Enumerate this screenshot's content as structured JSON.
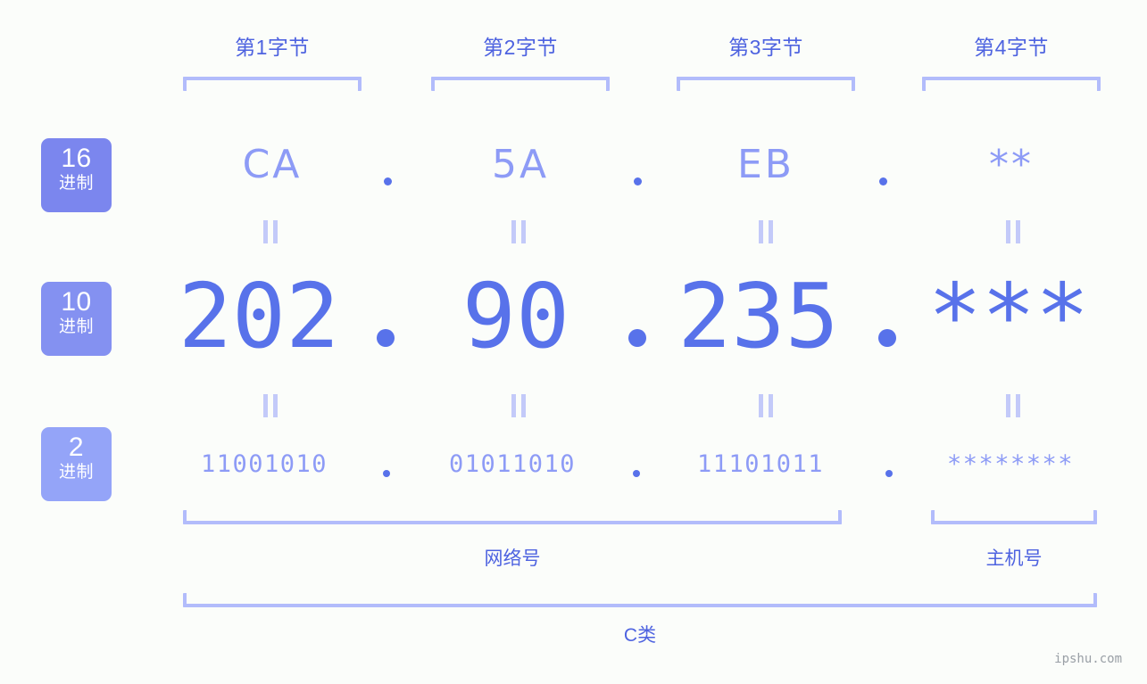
{
  "background_color": "#fbfdfa",
  "accent_colors": {
    "bracket": "#b2bcfb",
    "label_text": "#4e63e0",
    "value_strong": "#5872ea",
    "value_soft": "#8d9bf6",
    "equals": "#c3caf9",
    "badge_hex": "#7b86ee",
    "badge_dec": "#8491f1",
    "badge_bin": "#94a4f8",
    "watermark": "#9aa0a6"
  },
  "byte_headers": [
    {
      "label": "第1字节"
    },
    {
      "label": "第2字节"
    },
    {
      "label": "第3字节"
    },
    {
      "label": "第4字节"
    }
  ],
  "badges": [
    {
      "number": "16",
      "suffix": "进制"
    },
    {
      "number": "10",
      "suffix": "进制"
    },
    {
      "number": "2",
      "suffix": "进制"
    }
  ],
  "rows": {
    "hex": {
      "values": [
        "CA",
        "5A",
        "EB",
        "**"
      ]
    },
    "decimal": {
      "values": [
        "202",
        "90",
        "235",
        "***"
      ]
    },
    "binary": {
      "values": [
        "11001010",
        "01011010",
        "11101011",
        "********"
      ]
    }
  },
  "separators": {
    "hex": ".",
    "decimal": ".",
    "binary": "."
  },
  "equals_symbol": "=",
  "footer": {
    "network_label": "网络号",
    "host_label": "主机号",
    "class_label": "C类"
  },
  "watermark": "ipshu.com"
}
